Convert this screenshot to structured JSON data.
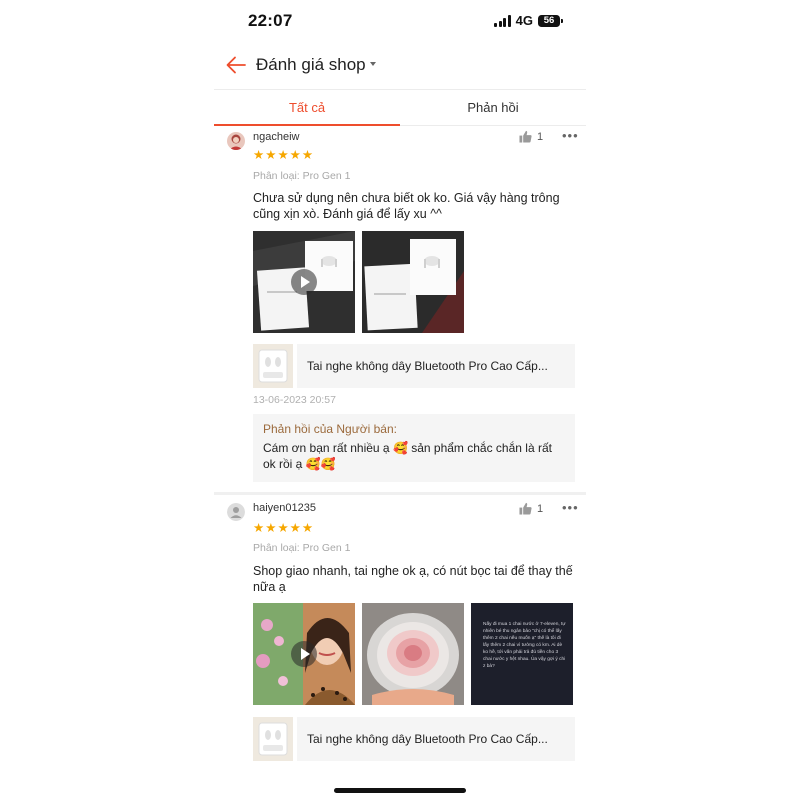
{
  "status_bar": {
    "time": "22:07",
    "network": "4G",
    "battery": "56",
    "icons": [
      "signal-icon",
      "battery-icon"
    ]
  },
  "header": {
    "title": "Đánh giá shop",
    "back_icon": "arrow-left-icon",
    "accent_color": "#ee4d2d"
  },
  "tabs": [
    {
      "label": "Tất cả",
      "active": true
    },
    {
      "label": "Phản hồi",
      "active": false
    }
  ],
  "reviews": [
    {
      "user": "ngacheiw",
      "likes": "1",
      "rating": 5,
      "variant": "Phân loại: Pro Gen 1",
      "comment": "Chưa sử dụng nên chưa biết ok ko. Giá vậy hàng trông cũng xịn xò. Đánh giá để lấy xu ^^",
      "media": [
        {
          "kind": "video"
        },
        {
          "kind": "image"
        }
      ],
      "product_name": "Tai nghe không dây Bluetooth Pro Cao Cấp...",
      "date": "13-06-2023 20:57",
      "seller_reply": {
        "title": "Phản hồi của Người bán:",
        "text": "Cám ơn bạn rất nhiều ạ 🥰 sản phẩm chắc chắn là rất ok rồi ạ 🥰🥰"
      }
    },
    {
      "user": "haiyen01235",
      "likes": "1",
      "rating": 5,
      "variant": "Phân loại: Pro Gen 1",
      "comment": "Shop giao nhanh, tai nghe ok ạ, có nút bọc tai để thay thế nữa ạ",
      "media": [
        {
          "kind": "video"
        },
        {
          "kind": "image"
        },
        {
          "kind": "image",
          "caption": "Nấy đi mua 1 chai nước ở 7-eleven, tự nhiên bé thu ngân bảo \"chị có thể lấy thêm 2 chai nếu muốn ạ\" thế là tôi đi lấy thêm 2 chai vì tưởng có km. Ai dè ko hề, tới vấn phải trả đủ tiền cho 3 chai nước y hệt nhau. Ủa vậy gợi ý chi z bà?"
        }
      ],
      "product_name": "Tai nghe không dây Bluetooth Pro Cao Cấp..."
    }
  ]
}
